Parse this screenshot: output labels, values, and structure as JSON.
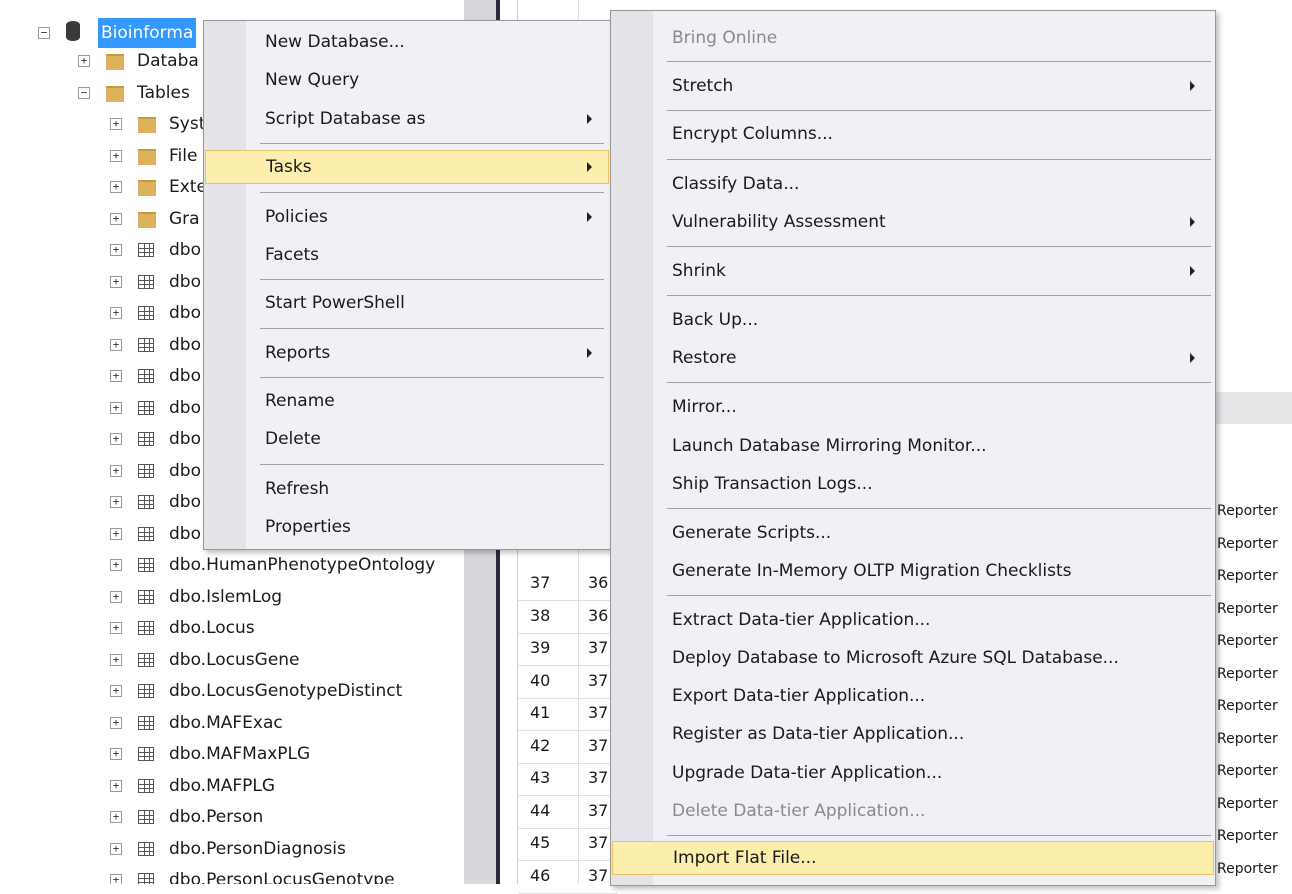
{
  "object_explorer": {
    "database_label": "Bioinforma",
    "nodes": [
      {
        "label": "Databa",
        "icon": "folder-icon"
      },
      {
        "label": "Tables",
        "icon": "folder-icon"
      },
      {
        "label": "Syst",
        "icon": "folder-icon"
      },
      {
        "label": "File",
        "icon": "folder-icon"
      },
      {
        "label": "Exte",
        "icon": "folder-icon"
      },
      {
        "label": "Gra",
        "icon": "folder-icon"
      },
      {
        "label": "dbo",
        "icon": "table-icon"
      },
      {
        "label": "dbo",
        "icon": "table-icon"
      },
      {
        "label": "dbo",
        "icon": "table-icon"
      },
      {
        "label": "dbo",
        "icon": "table-icon"
      },
      {
        "label": "dbo",
        "icon": "table-icon"
      },
      {
        "label": "dbo",
        "icon": "table-icon"
      },
      {
        "label": "dbo",
        "icon": "table-icon"
      },
      {
        "label": "dbo",
        "icon": "table-icon"
      },
      {
        "label": "dbo",
        "icon": "table-icon"
      },
      {
        "label": "dbo",
        "icon": "table-icon"
      },
      {
        "label": "dbo.HumanPhenotypeOntology",
        "icon": "table-icon"
      },
      {
        "label": "dbo.IslemLog",
        "icon": "table-icon"
      },
      {
        "label": "dbo.Locus",
        "icon": "table-icon"
      },
      {
        "label": "dbo.LocusGene",
        "icon": "table-icon"
      },
      {
        "label": "dbo.LocusGenotypeDistinct",
        "icon": "table-icon"
      },
      {
        "label": "dbo.MAFExac",
        "icon": "table-icon"
      },
      {
        "label": "dbo.MAFMaxPLG",
        "icon": "table-icon"
      },
      {
        "label": "dbo.MAFPLG",
        "icon": "table-icon"
      },
      {
        "label": "dbo.Person",
        "icon": "table-icon"
      },
      {
        "label": "dbo.PersonDiagnosis",
        "icon": "table-icon"
      },
      {
        "label": "dbo.PersonLocusGenotype",
        "icon": "table-icon"
      }
    ]
  },
  "grid": {
    "rows": [
      {
        "a": "37",
        "b": "36"
      },
      {
        "a": "38",
        "b": "36"
      },
      {
        "a": "39",
        "b": "37"
      },
      {
        "a": "40",
        "b": "37"
      },
      {
        "a": "41",
        "b": "37"
      },
      {
        "a": "42",
        "b": "37"
      },
      {
        "a": "43",
        "b": "37"
      },
      {
        "a": "44",
        "b": "37"
      },
      {
        "a": "45",
        "b": "37"
      },
      {
        "a": "46",
        "b": "37"
      }
    ],
    "right_column_text": "Reporter"
  },
  "context_menu": {
    "new_database": "New Database...",
    "new_query": "New Query",
    "script_database_as": "Script Database as",
    "tasks": "Tasks",
    "policies": "Policies",
    "facets": "Facets",
    "start_powershell": "Start PowerShell",
    "reports": "Reports",
    "rename": "Rename",
    "delete": "Delete",
    "refresh": "Refresh",
    "properties": "Properties"
  },
  "tasks_menu": {
    "bring_online": "Bring Online",
    "stretch": "Stretch",
    "encrypt_columns": "Encrypt Columns...",
    "classify_data": "Classify Data...",
    "vulnerability_assessment": "Vulnerability Assessment",
    "shrink": "Shrink",
    "back_up": "Back Up...",
    "restore": "Restore",
    "mirror": "Mirror...",
    "launch_mirroring_monitor": "Launch Database Mirroring Monitor...",
    "ship_transaction_logs": "Ship Transaction Logs...",
    "generate_scripts": "Generate Scripts...",
    "generate_inmemory_checklists": "Generate In-Memory OLTP Migration Checklists",
    "extract_data_tier": "Extract Data-tier Application...",
    "deploy_to_azure": "Deploy Database to Microsoft Azure SQL Database...",
    "export_data_tier": "Export Data-tier Application...",
    "register_data_tier": "Register as Data-tier Application...",
    "upgrade_data_tier": "Upgrade Data-tier Application...",
    "delete_data_tier": "Delete Data-tier Application...",
    "import_flat_file": "Import Flat File..."
  },
  "colors": {
    "selection_blue": "#3399ff",
    "menu_background": "#f0f0f5",
    "menu_highlight": "#fcefad"
  }
}
